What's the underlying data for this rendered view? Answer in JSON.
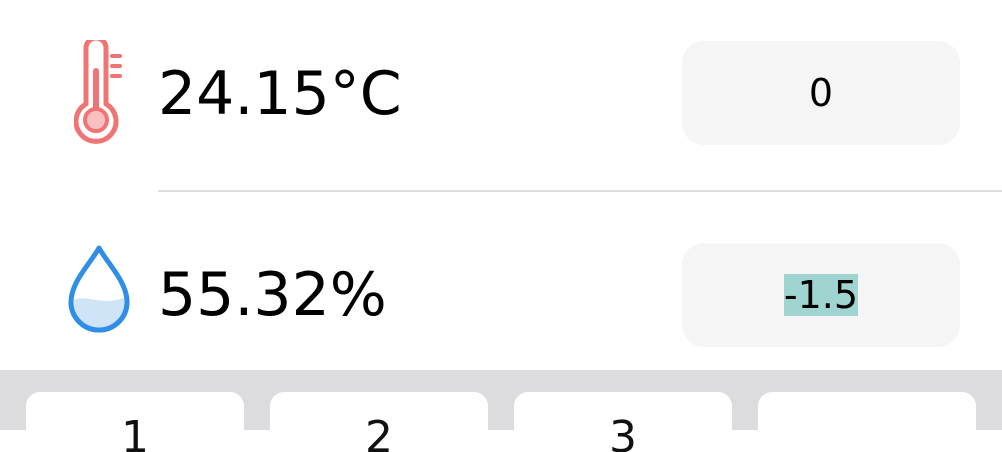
{
  "temperature": {
    "icon": "thermometer-icon",
    "value": "24.15°C",
    "offset": "0",
    "icon_color": "#f07474"
  },
  "humidity": {
    "icon": "water-drop-icon",
    "value": "55.32%",
    "offset": "-1.5",
    "icon_color": "#2f8fe6"
  },
  "keyboard": {
    "keys": [
      {
        "label": "1"
      },
      {
        "label": "2"
      },
      {
        "label": "3"
      },
      {
        "label": ""
      }
    ]
  },
  "colors": {
    "selection": "#9fd4d0",
    "input_background": "#f5f5f5",
    "keyboard_background": "#dcdcdf"
  }
}
